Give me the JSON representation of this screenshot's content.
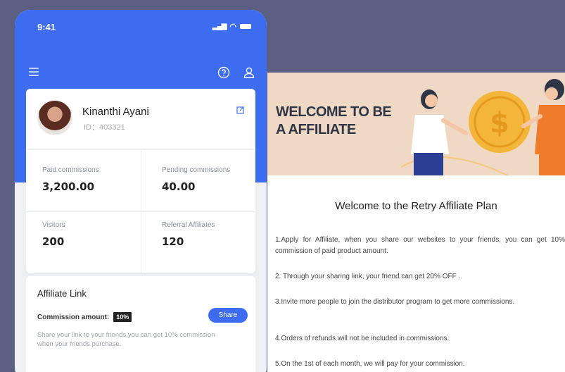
{
  "status_bar": {
    "time": "9:41"
  },
  "profile": {
    "name": "Kinanthi Ayani",
    "id": "ID：403321"
  },
  "stats": [
    {
      "label": "Paid commissions",
      "value": "3,200.00"
    },
    {
      "label": "Pending commissions",
      "value": "40.00"
    },
    {
      "label": "Visitors",
      "value": "200"
    },
    {
      "label": "Referral Affiliates",
      "value": "120"
    }
  ],
  "affiliate_link": {
    "title": "Affiliate Link",
    "commission_label": "Commission amount:",
    "commission_value": "10%",
    "share_button": "Share",
    "description": "Share your link to your friends,you can get 10% commission when your friends purchase."
  },
  "document": {
    "banner_title": "WELCOME TO BE A AFFILIATE",
    "heading": "Welcome to the Retry Affiliate Plan",
    "paragraphs": [
      "1.Apply for Affiliate, when you share our websites to your friends, you can get 10% commission of paid product amount.",
      "2. Through your sharing link, your friend can get 20% OFF .",
      "3.Invite more people to join the distributor program to get more commissions.",
      "4.Orders of refunds will not be included in commissions.",
      "5.On the 1st of each month, we will pay for your commission."
    ]
  },
  "colors": {
    "primary": "#3d6cf0",
    "background": "#5b5f83",
    "banner": "#f0d9c4",
    "coin": "#f4b63a"
  },
  "icons": [
    "menu-icon",
    "help-icon",
    "user-icon",
    "edit-icon",
    "signal-icon",
    "wifi-icon",
    "battery-icon"
  ]
}
